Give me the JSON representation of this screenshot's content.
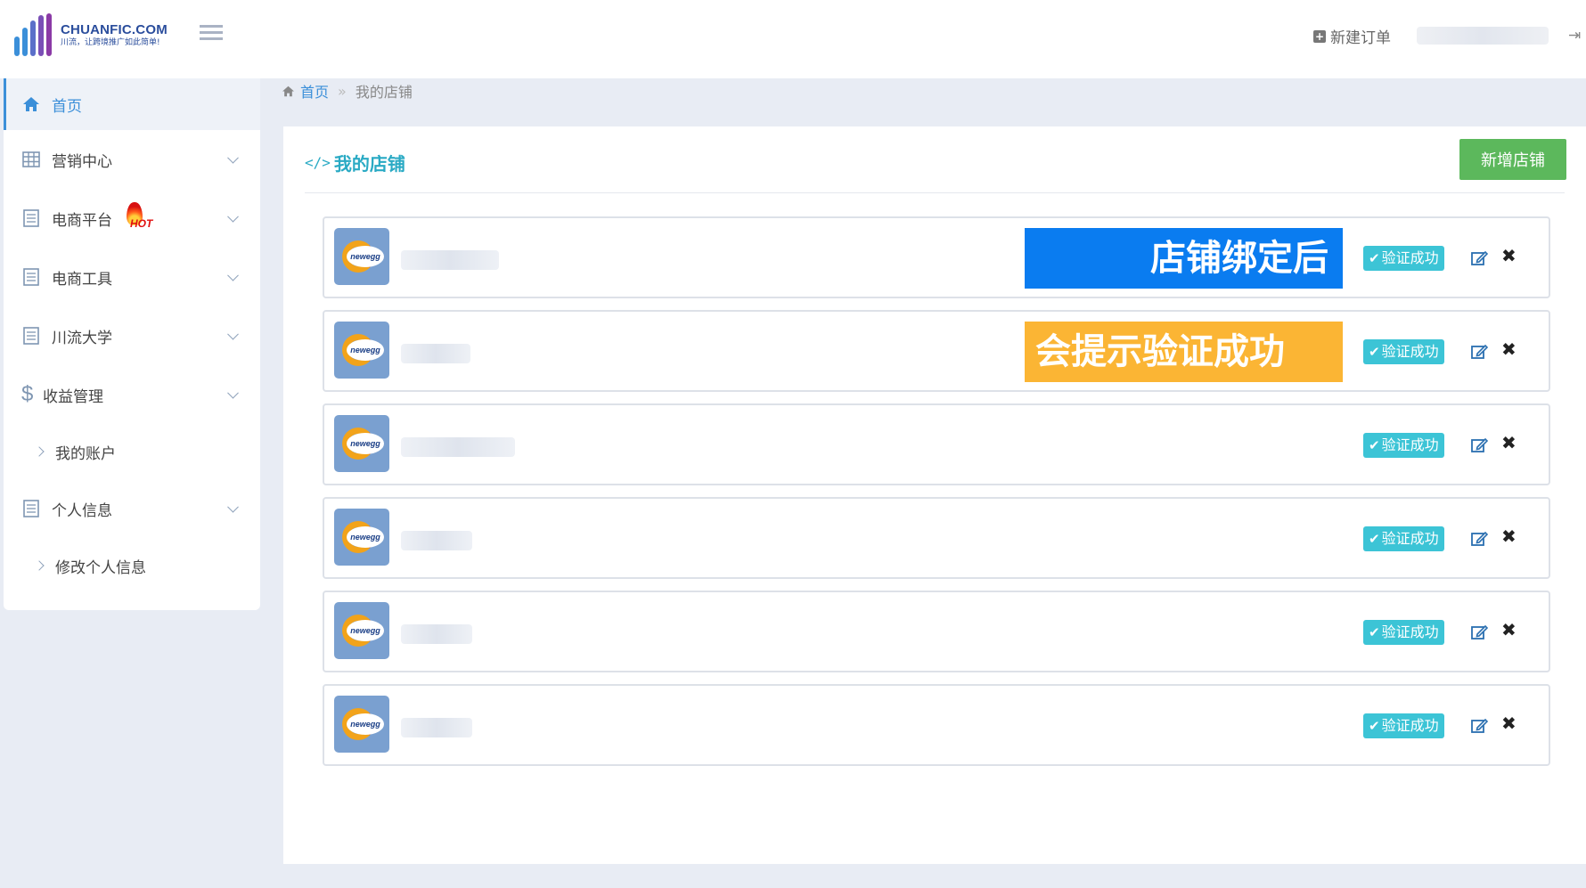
{
  "header": {
    "logo_title": "CHUANFIC.COM",
    "logo_slogan": "川流，让跨境推广如此简单!",
    "new_order_label": "新建订单"
  },
  "sidebar": {
    "items": [
      {
        "label": "首页",
        "icon": "home-icon",
        "active": true
      },
      {
        "label": "营销中心",
        "icon": "grid-icon"
      },
      {
        "label": "电商平台",
        "icon": "list-icon",
        "badge": "HOT"
      },
      {
        "label": "电商工具",
        "icon": "list-icon"
      },
      {
        "label": "川流大学",
        "icon": "list-icon"
      },
      {
        "label": "收益管理",
        "icon": "dollar-icon"
      },
      {
        "label": "个人信息",
        "icon": "list-icon"
      }
    ],
    "sub_items": {
      "income": "我的账户",
      "profile": "修改个人信息"
    }
  },
  "breadcrumb": {
    "home": "首页",
    "separator": "»",
    "current": "我的店铺"
  },
  "panel": {
    "title": "我的店铺",
    "add_button": "新增店铺"
  },
  "shops": [
    {
      "logo": "newegg",
      "status": "验证成功"
    },
    {
      "logo": "newegg",
      "status": "验证成功"
    },
    {
      "logo": "newegg",
      "status": "验证成功"
    },
    {
      "logo": "newegg",
      "status": "验证成功"
    },
    {
      "logo": "newegg",
      "status": "验证成功"
    },
    {
      "logo": "newegg",
      "status": "验证成功"
    }
  ],
  "callouts": {
    "line1": "店铺绑定后",
    "line2": "会提示验证成功"
  },
  "colors": {
    "accent": "#3b8fd9",
    "title": "#2aaac4",
    "add_button": "#5cb85c",
    "verified": "#3cc4d6",
    "callout_blue": "#0a7cf0",
    "callout_orange": "#fbb534"
  }
}
